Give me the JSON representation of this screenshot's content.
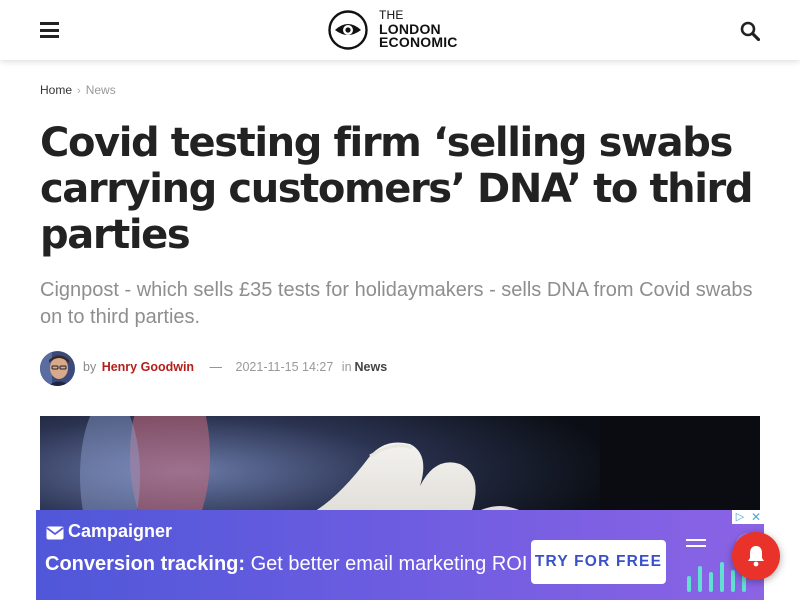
{
  "header": {
    "logo": {
      "line1": "THE",
      "line2": "LONDON",
      "line3": "ECONOMIC"
    },
    "icons": {
      "menu": "menu-icon",
      "search": "search-icon"
    }
  },
  "breadcrumb": {
    "home": "Home",
    "current": "News"
  },
  "article": {
    "title": "Covid testing firm ‘selling swabs carrying customers’ DNA’ to third parties",
    "subtitle": "Cignpost - which sells £35 tests for holidaymakers - sells DNA from Covid swabs on to third parties.",
    "meta": {
      "by_label": "by",
      "author": "Henry Goodwin",
      "separator": "—",
      "date": "2021-11-15 14:27",
      "in_label": "in",
      "category": "News"
    }
  },
  "ad": {
    "brand": "Campaigner",
    "headline_bold": "Conversion tracking:",
    "headline_rest": " Get better email marketing ROI",
    "cta": "TRY FOR FREE",
    "choices_icon": "adchoices-icon",
    "close": "✕"
  },
  "colors": {
    "author": "#b3201b",
    "title": "#222222",
    "ad_start": "#4f57d8",
    "ad_end": "#8c63e5",
    "bell": "#e8322a"
  }
}
